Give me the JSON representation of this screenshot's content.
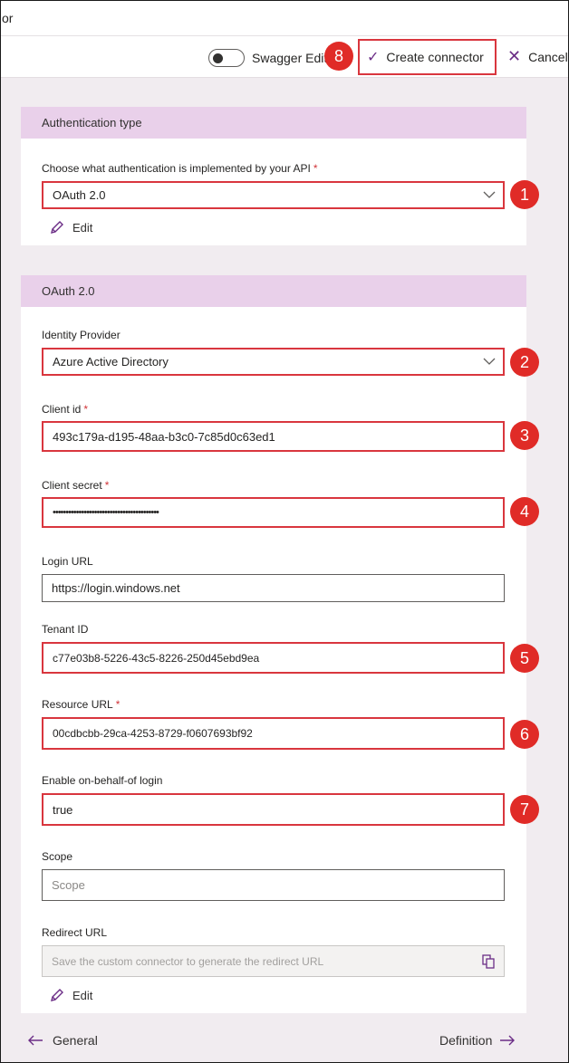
{
  "window": {
    "title": "or"
  },
  "toolbar": {
    "swagger_label": "Swagger Editor",
    "create_label": "Create connector",
    "cancel_label": "Cancel"
  },
  "auth_card": {
    "header": "Authentication type",
    "field_label": "Choose what authentication is implemented by your API",
    "field_value": "OAuth 2.0",
    "edit_label": "Edit"
  },
  "oauth_card": {
    "header": "OAuth 2.0",
    "identity_provider": {
      "label": "Identity Provider",
      "value": "Azure Active Directory"
    },
    "client_id": {
      "label": "Client id",
      "value": "493c179a-d195-48aa-b3c0-7c85d0c63ed1"
    },
    "client_secret": {
      "label": "Client secret",
      "value": "•••••••••••••••••••••••••••••••••••••••••"
    },
    "login_url": {
      "label": "Login URL",
      "value": "https://login.windows.net"
    },
    "tenant_id": {
      "label": "Tenant ID",
      "value": "c77e03b8-5226-43c5-8226-250d45ebd9ea"
    },
    "resource_url": {
      "label": "Resource URL",
      "value": "00cdbcbb-29ca-4253-8729-f0607693bf92"
    },
    "on_behalf": {
      "label": "Enable on-behalf-of login",
      "value": "true"
    },
    "scope": {
      "label": "Scope",
      "placeholder": "Scope"
    },
    "redirect_url": {
      "label": "Redirect URL",
      "placeholder": "Save the custom connector to generate the redirect URL"
    },
    "edit_label": "Edit"
  },
  "required_mark": "*",
  "badges": [
    "1",
    "2",
    "3",
    "4",
    "5",
    "6",
    "7",
    "8"
  ],
  "footer": {
    "prev_label": "General",
    "next_label": "Definition"
  },
  "colors": {
    "accent": "#6b2d86",
    "header_bg": "#e9d0ea",
    "highlight": "#d9363e",
    "badge": "#e02b27"
  }
}
